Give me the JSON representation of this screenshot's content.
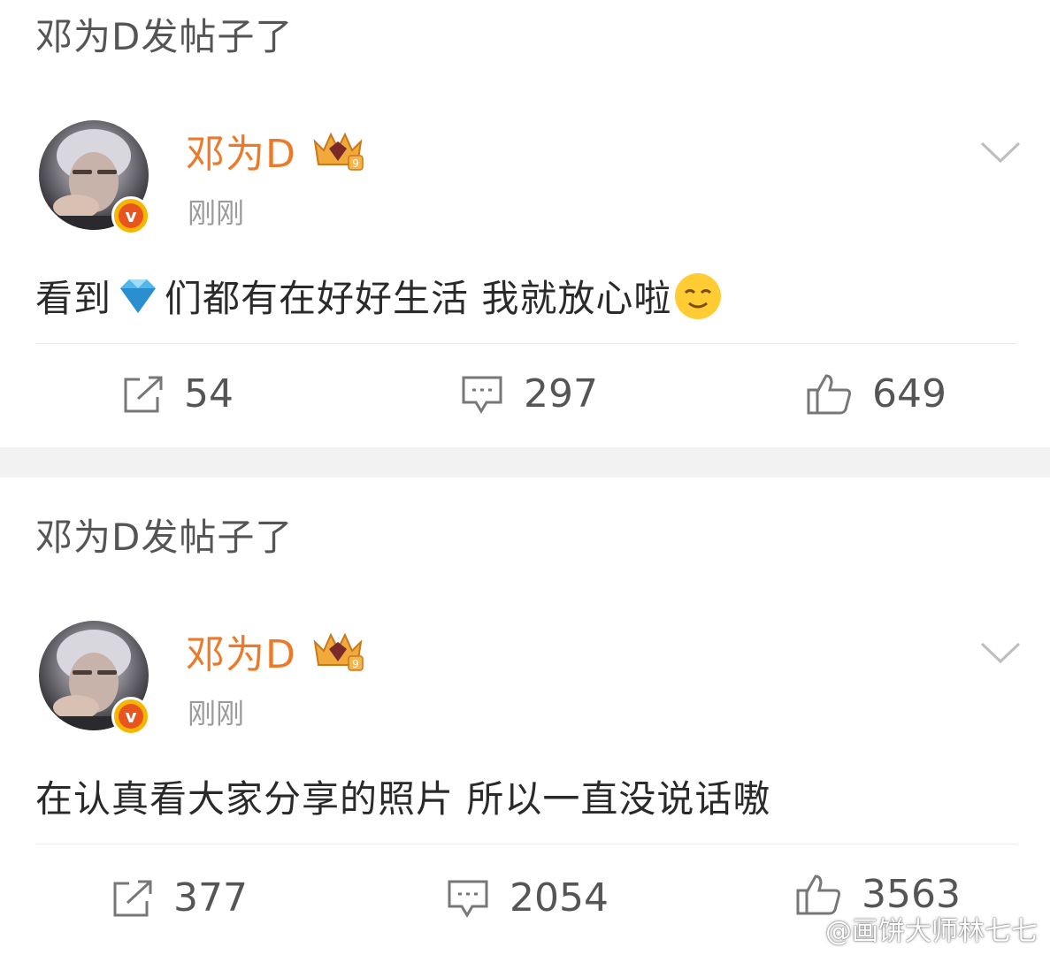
{
  "posts": [
    {
      "banner": "邓为D发帖子了",
      "author": "邓为D",
      "time": "刚刚",
      "text_parts": [
        "看到",
        "们都有在好好生活 我就放心啦"
      ],
      "inline_icons": [
        "diamond-emoji",
        "relieved-face-emoji"
      ],
      "repost_count": "54",
      "comment_count": "297",
      "like_count": "649"
    },
    {
      "banner": "邓为D发帖子了",
      "author": "邓为D",
      "time": "刚刚",
      "text_parts": [
        "在认真看大家分享的照片 所以一直没说话嗷"
      ],
      "inline_icons": [],
      "repost_count": "377",
      "comment_count": "2054",
      "like_count": "3563"
    }
  ],
  "watermark": {
    "text": "@画饼大师林七七",
    "icon": "weibo-logo-icon"
  },
  "colors": {
    "username": "#eb7a2a",
    "verified_badge": "#f6b500",
    "text": "#2a2a2a",
    "meta": "#9b9b9b"
  }
}
